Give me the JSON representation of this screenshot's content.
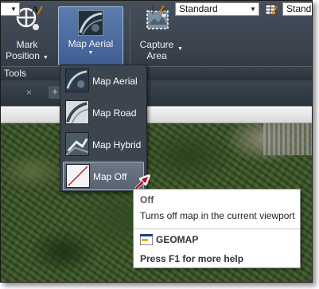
{
  "ribbon": {
    "mark_position": {
      "label_line1": "Mark",
      "label_line2": "Position",
      "icon": "mark-position-icon"
    },
    "map_aerial": {
      "label": "Map Aerial",
      "icon": "map-aerial-icon"
    },
    "capture_area": {
      "label_line1": "Capture",
      "label_line2": "Area",
      "icon": "capture-area-icon"
    },
    "panel_label": "Tools"
  },
  "tabstrip": {
    "close_glyph": "×",
    "new_tab_glyph": "+"
  },
  "properties_toolbar": {
    "text_style_value": "Standard",
    "table_style_value": "Stand"
  },
  "map_menu": {
    "items": [
      {
        "label": "Map Aerial",
        "icon": "map-aerial-icon"
      },
      {
        "label": "Map Road",
        "icon": "map-road-icon"
      },
      {
        "label": "Map Hybrid",
        "icon": "map-hybrid-icon"
      },
      {
        "label": "Map Off",
        "icon": "map-off-icon",
        "hovered": true
      }
    ]
  },
  "tooltip": {
    "title": "Off",
    "description": "Turns off map in the current viewport",
    "command": "GEOMAP",
    "help": "Press F1 for more help"
  },
  "colors": {
    "ribbon_bg": "#3f4852",
    "selected_button": "#5576a9",
    "menu_bg": "#3c444e",
    "cursor_red": "#b3001b"
  }
}
